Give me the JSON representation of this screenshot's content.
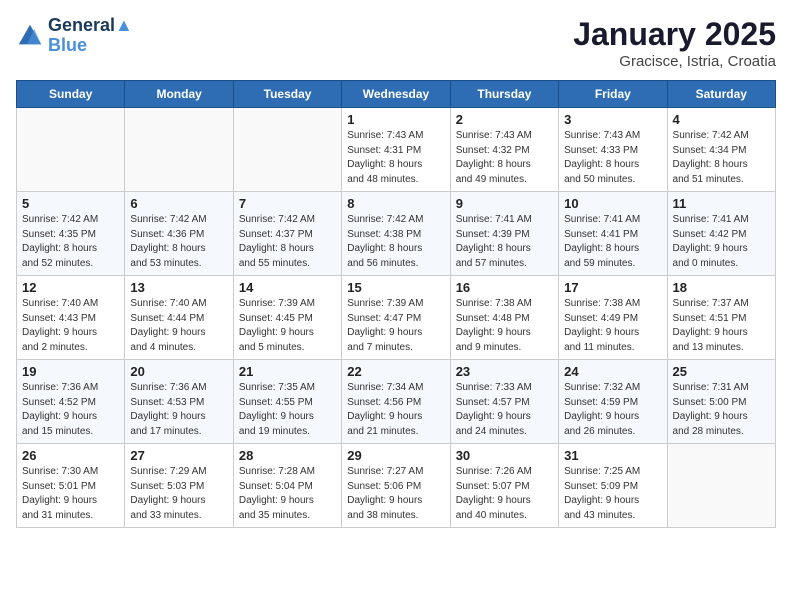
{
  "header": {
    "logo_line1": "General",
    "logo_line2": "Blue",
    "title": "January 2025",
    "subtitle": "Gracisce, Istria, Croatia"
  },
  "weekdays": [
    "Sunday",
    "Monday",
    "Tuesday",
    "Wednesday",
    "Thursday",
    "Friday",
    "Saturday"
  ],
  "weeks": [
    [
      {
        "day": "",
        "info": ""
      },
      {
        "day": "",
        "info": ""
      },
      {
        "day": "",
        "info": ""
      },
      {
        "day": "1",
        "info": "Sunrise: 7:43 AM\nSunset: 4:31 PM\nDaylight: 8 hours\nand 48 minutes."
      },
      {
        "day": "2",
        "info": "Sunrise: 7:43 AM\nSunset: 4:32 PM\nDaylight: 8 hours\nand 49 minutes."
      },
      {
        "day": "3",
        "info": "Sunrise: 7:43 AM\nSunset: 4:33 PM\nDaylight: 8 hours\nand 50 minutes."
      },
      {
        "day": "4",
        "info": "Sunrise: 7:42 AM\nSunset: 4:34 PM\nDaylight: 8 hours\nand 51 minutes."
      }
    ],
    [
      {
        "day": "5",
        "info": "Sunrise: 7:42 AM\nSunset: 4:35 PM\nDaylight: 8 hours\nand 52 minutes."
      },
      {
        "day": "6",
        "info": "Sunrise: 7:42 AM\nSunset: 4:36 PM\nDaylight: 8 hours\nand 53 minutes."
      },
      {
        "day": "7",
        "info": "Sunrise: 7:42 AM\nSunset: 4:37 PM\nDaylight: 8 hours\nand 55 minutes."
      },
      {
        "day": "8",
        "info": "Sunrise: 7:42 AM\nSunset: 4:38 PM\nDaylight: 8 hours\nand 56 minutes."
      },
      {
        "day": "9",
        "info": "Sunrise: 7:41 AM\nSunset: 4:39 PM\nDaylight: 8 hours\nand 57 minutes."
      },
      {
        "day": "10",
        "info": "Sunrise: 7:41 AM\nSunset: 4:41 PM\nDaylight: 8 hours\nand 59 minutes."
      },
      {
        "day": "11",
        "info": "Sunrise: 7:41 AM\nSunset: 4:42 PM\nDaylight: 9 hours\nand 0 minutes."
      }
    ],
    [
      {
        "day": "12",
        "info": "Sunrise: 7:40 AM\nSunset: 4:43 PM\nDaylight: 9 hours\nand 2 minutes."
      },
      {
        "day": "13",
        "info": "Sunrise: 7:40 AM\nSunset: 4:44 PM\nDaylight: 9 hours\nand 4 minutes."
      },
      {
        "day": "14",
        "info": "Sunrise: 7:39 AM\nSunset: 4:45 PM\nDaylight: 9 hours\nand 5 minutes."
      },
      {
        "day": "15",
        "info": "Sunrise: 7:39 AM\nSunset: 4:47 PM\nDaylight: 9 hours\nand 7 minutes."
      },
      {
        "day": "16",
        "info": "Sunrise: 7:38 AM\nSunset: 4:48 PM\nDaylight: 9 hours\nand 9 minutes."
      },
      {
        "day": "17",
        "info": "Sunrise: 7:38 AM\nSunset: 4:49 PM\nDaylight: 9 hours\nand 11 minutes."
      },
      {
        "day": "18",
        "info": "Sunrise: 7:37 AM\nSunset: 4:51 PM\nDaylight: 9 hours\nand 13 minutes."
      }
    ],
    [
      {
        "day": "19",
        "info": "Sunrise: 7:36 AM\nSunset: 4:52 PM\nDaylight: 9 hours\nand 15 minutes."
      },
      {
        "day": "20",
        "info": "Sunrise: 7:36 AM\nSunset: 4:53 PM\nDaylight: 9 hours\nand 17 minutes."
      },
      {
        "day": "21",
        "info": "Sunrise: 7:35 AM\nSunset: 4:55 PM\nDaylight: 9 hours\nand 19 minutes."
      },
      {
        "day": "22",
        "info": "Sunrise: 7:34 AM\nSunset: 4:56 PM\nDaylight: 9 hours\nand 21 minutes."
      },
      {
        "day": "23",
        "info": "Sunrise: 7:33 AM\nSunset: 4:57 PM\nDaylight: 9 hours\nand 24 minutes."
      },
      {
        "day": "24",
        "info": "Sunrise: 7:32 AM\nSunset: 4:59 PM\nDaylight: 9 hours\nand 26 minutes."
      },
      {
        "day": "25",
        "info": "Sunrise: 7:31 AM\nSunset: 5:00 PM\nDaylight: 9 hours\nand 28 minutes."
      }
    ],
    [
      {
        "day": "26",
        "info": "Sunrise: 7:30 AM\nSunset: 5:01 PM\nDaylight: 9 hours\nand 31 minutes."
      },
      {
        "day": "27",
        "info": "Sunrise: 7:29 AM\nSunset: 5:03 PM\nDaylight: 9 hours\nand 33 minutes."
      },
      {
        "day": "28",
        "info": "Sunrise: 7:28 AM\nSunset: 5:04 PM\nDaylight: 9 hours\nand 35 minutes."
      },
      {
        "day": "29",
        "info": "Sunrise: 7:27 AM\nSunset: 5:06 PM\nDaylight: 9 hours\nand 38 minutes."
      },
      {
        "day": "30",
        "info": "Sunrise: 7:26 AM\nSunset: 5:07 PM\nDaylight: 9 hours\nand 40 minutes."
      },
      {
        "day": "31",
        "info": "Sunrise: 7:25 AM\nSunset: 5:09 PM\nDaylight: 9 hours\nand 43 minutes."
      },
      {
        "day": "",
        "info": ""
      }
    ]
  ]
}
